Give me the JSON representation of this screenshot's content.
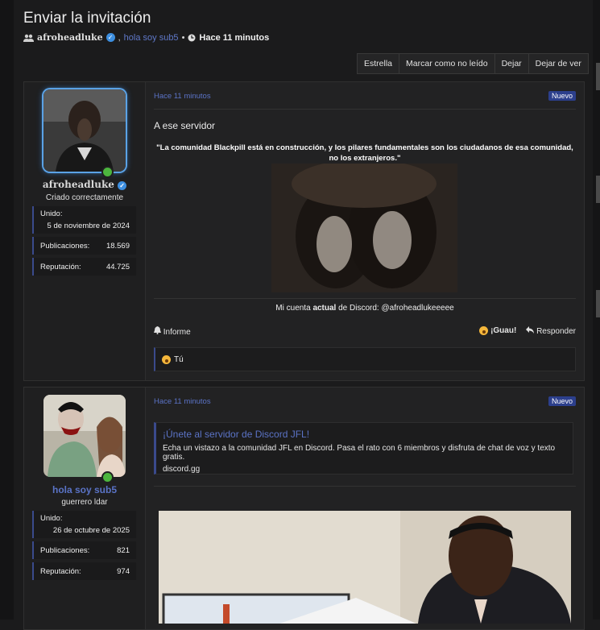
{
  "thread": {
    "title": "Enviar la invitación",
    "author": "afroheadluke",
    "separator": ",",
    "participant": "hola soy sub5",
    "bullet": "•",
    "time": "Hace 11 minutos"
  },
  "toolbar": {
    "star": "Estrella",
    "mark_unread": "Marcar como no leído",
    "leave": "Dejar",
    "unwatch": "Dejar de ver"
  },
  "posts": [
    {
      "user": {
        "name": "afroheadluke",
        "title": "Criado correctamente",
        "joined_label": "Unido:",
        "joined": "5 de noviembre de 2024",
        "posts_label": "Publicaciones:",
        "posts": "18.569",
        "rep_label": "Reputación:",
        "rep": "44.725"
      },
      "time": "Hace 11 minutos",
      "badge": "Nuevo",
      "subject": "A ese servidor",
      "quote": "\"La comunidad Blackpill está en construcción, y los pilares fundamentales son los ciudadanos de esa comunidad, no los extranjeros.\"",
      "signature": {
        "prefix": "Mi cuenta ",
        "bold": "actual",
        "suffix": " de Discord: @afroheadlukeeeee"
      },
      "actions": {
        "report": "Informe",
        "reaction": "¡Guau!",
        "reply": "Responder"
      },
      "reactions_text": "Tú"
    },
    {
      "user": {
        "name": "hola soy sub5",
        "title": "guerrero ldar",
        "joined_label": "Unido:",
        "joined": "26 de octubre de 2025",
        "posts_label": "Publicaciones:",
        "posts": "821",
        "rep_label": "Reputación:",
        "rep": "974"
      },
      "time": "Hace 11 minutos",
      "badge": "Nuevo",
      "embed": {
        "title": "¡Únete al servidor de Discord JFL!",
        "description": "Echa un vistazo a la comunidad JFL en Discord. Pasa el rato con 6 miembros y disfruta de chat de voz y texto gratis.",
        "site": "discord.gg"
      }
    }
  ],
  "colors": {
    "accent": "#5b73c6",
    "badge": "#2c3f8c",
    "online": "#4cb53e",
    "verified": "#3d8fe0"
  },
  "icons": [
    "users-icon",
    "verified-icon",
    "clock-icon",
    "bell-icon",
    "reply-icon",
    "emoji-wow-icon"
  ]
}
